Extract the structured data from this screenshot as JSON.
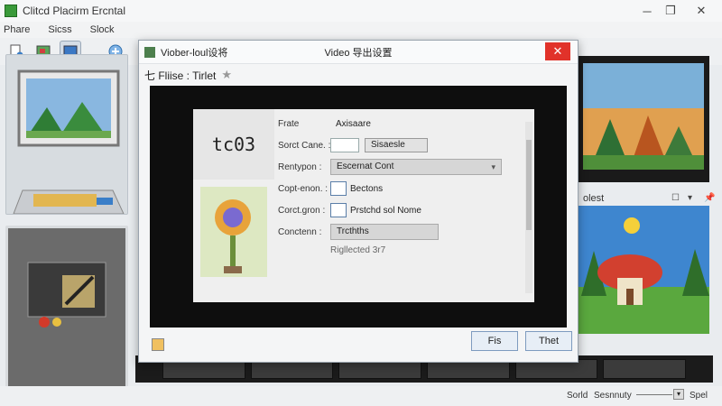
{
  "window": {
    "title": "Clitcd Placirm Ercntal"
  },
  "menu": {
    "items": [
      "Phare",
      "Sicss",
      "Slock"
    ]
  },
  "toolbar": {
    "buttons": [
      "import",
      "image",
      "display",
      "effects"
    ]
  },
  "dialog": {
    "left_title": "Viober-loul设将",
    "center_title": "Video 导出设置",
    "close_glyph": "✕",
    "header_label": "七 Fliise :  Tirlet",
    "logo_text": "tc03",
    "form": {
      "row0": {
        "label": "Frate",
        "value": "Axisaare"
      },
      "row1": {
        "label": "Sorct Cane. :",
        "button": "Sisaesle"
      },
      "row2": {
        "label": "Rentypon :",
        "value": "Escernat Cont"
      },
      "row3": {
        "label": "Copt-enon. :",
        "value": "Bectons"
      },
      "row4": {
        "label": "Corct.gron :",
        "value": "Prstchd sol Nome"
      },
      "row5": {
        "label": "Conctenn :",
        "value": "Trcthths"
      },
      "row6": {
        "label": "",
        "value": "Rigllected 3r7"
      }
    },
    "buttons": {
      "ok": "Fis",
      "cancel": "Thet"
    }
  },
  "right_panel": {
    "label": "olest"
  },
  "status": {
    "left": "Sorld",
    "middle": "Sesnnuty",
    "right": "Spel"
  },
  "colors": {
    "close": "#e1322a",
    "accent": "#4d7f4d"
  }
}
